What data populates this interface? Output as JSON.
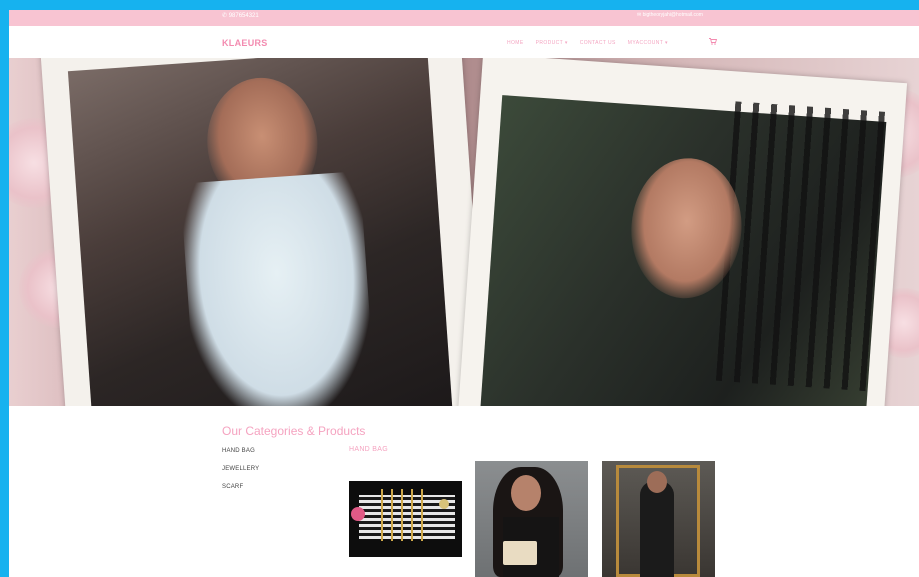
{
  "topbar": {
    "phone": "✆ 987654321",
    "email": "✉ bigtheoryjahi@hotmail.com"
  },
  "nav": {
    "logo": "KLAEURS",
    "items": [
      {
        "label": "HOME"
      },
      {
        "label": "PRODUCT ▾"
      },
      {
        "label": "CONTACT US"
      },
      {
        "label": "MYACCOUNT ▾"
      }
    ],
    "cart_icon": "cart-icon"
  },
  "hero": {
    "images": [
      "woman-in-scarf-polaroid",
      "woman-by-fence-polaroid"
    ]
  },
  "categories": {
    "title": "Our Categories & Products",
    "items": [
      {
        "label": "HAND BAG"
      },
      {
        "label": "JEWELLERY"
      },
      {
        "label": "SCARF"
      }
    ],
    "active_heading": "HAND BAG"
  },
  "colors": {
    "accent": "#f38bb0",
    "topbar": "#f8c4d2",
    "frame": "#16b2ef"
  }
}
